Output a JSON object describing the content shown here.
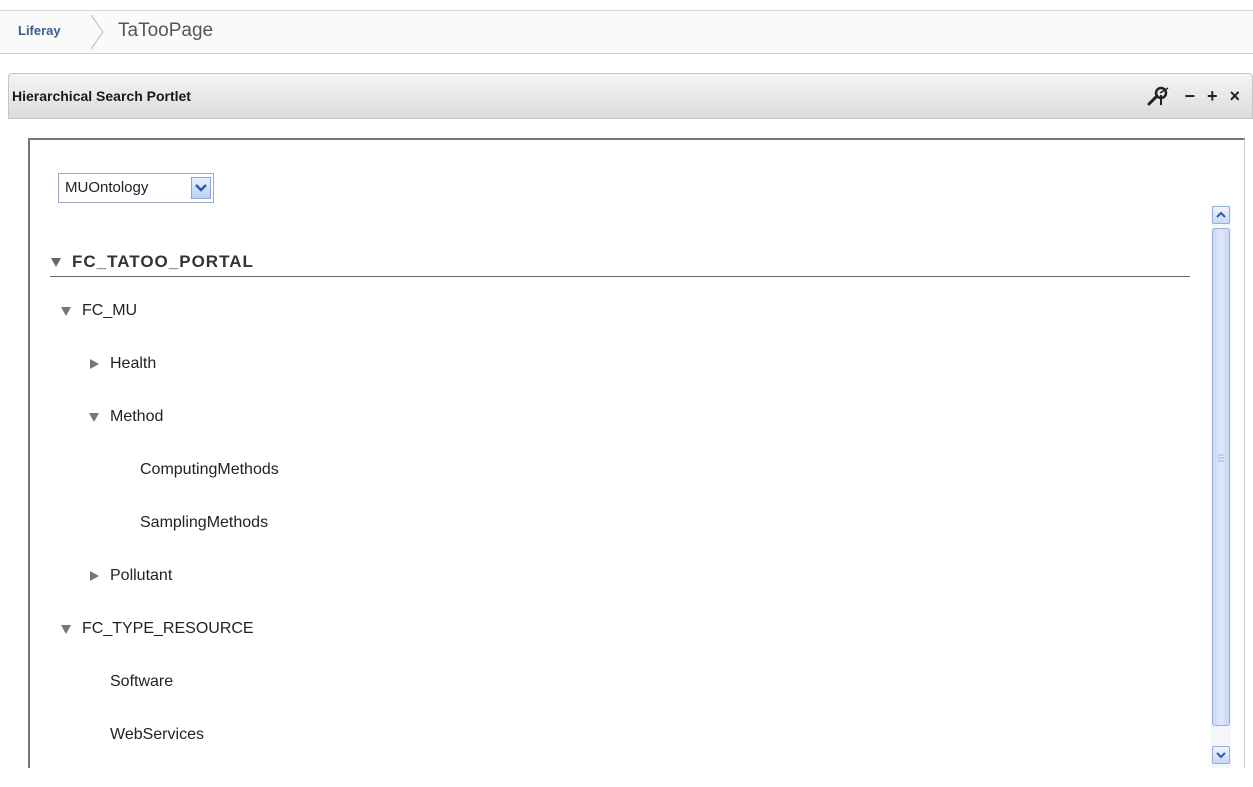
{
  "breadcrumb": {
    "home_label": "Liferay",
    "page_title": "TaTooPage"
  },
  "portlet": {
    "title": "Hierarchical Search Portlet",
    "icons": {
      "config": "wrench-icon",
      "minimize": "−",
      "maximize": "+",
      "close": "×"
    },
    "ontology_select": {
      "value": "MUOntology"
    },
    "tree": {
      "root": {
        "label": "FC_TATOO_PORTAL",
        "expanded": true
      },
      "nodes": [
        {
          "label": "FC_MU",
          "expanded": true
        },
        {
          "label": "Health",
          "expanded": false
        },
        {
          "label": "Method",
          "expanded": true
        },
        {
          "label": "ComputingMethods"
        },
        {
          "label": "SamplingMethods"
        },
        {
          "label": "Pollutant",
          "expanded": false
        },
        {
          "label": "FC_TYPE_RESOURCE",
          "expanded": true
        },
        {
          "label": "Software"
        },
        {
          "label": "WebServices"
        }
      ]
    }
  },
  "colors": {
    "home_link": "#3a5f8f",
    "scrollbar_accent": "#98aed6"
  }
}
